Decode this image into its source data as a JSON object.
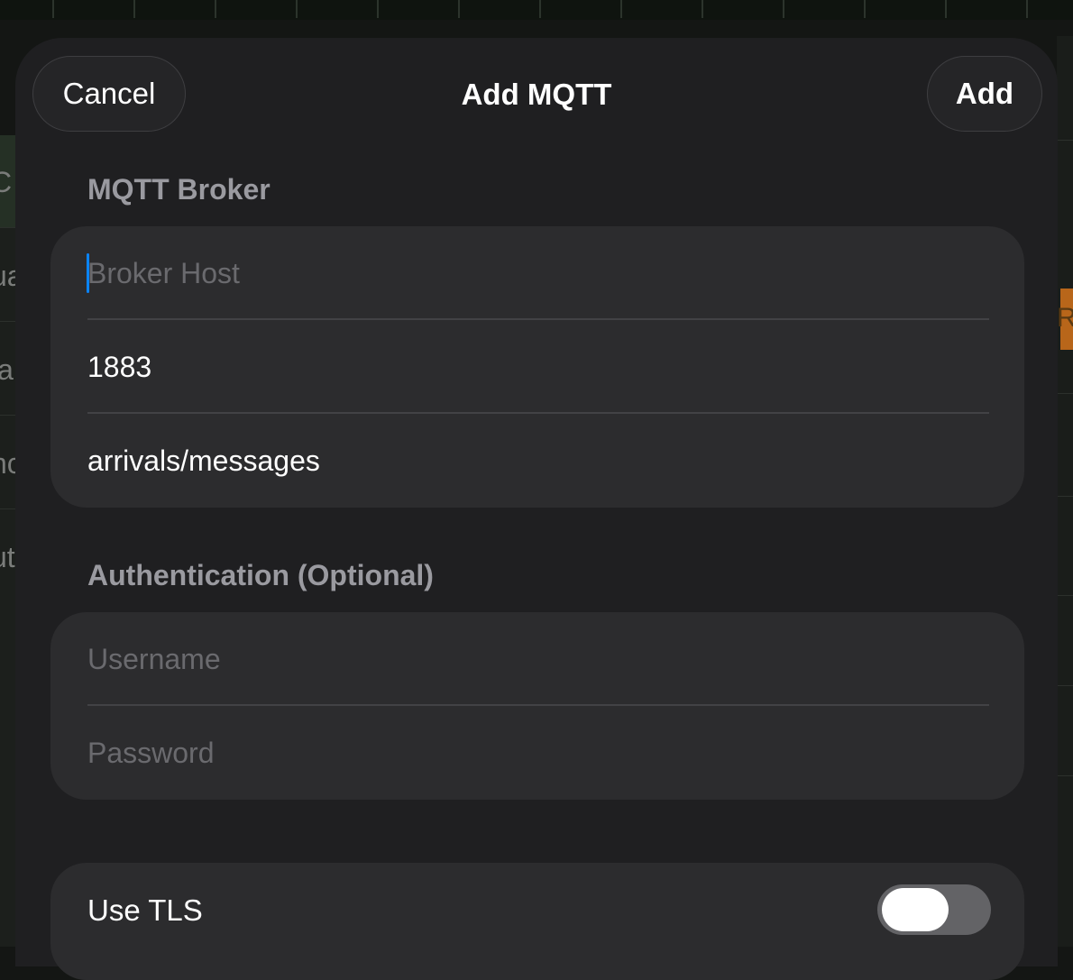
{
  "nav": {
    "cancel_label": "Cancel",
    "title": "Add MQTT",
    "add_label": "Add"
  },
  "broker": {
    "header": "MQTT Broker",
    "host_placeholder": "Broker Host",
    "host_value": "",
    "port_value": "1883",
    "topic_value": "arrivals/messages"
  },
  "auth": {
    "header": "Authentication (Optional)",
    "username_placeholder": "Username",
    "password_placeholder": "Password"
  },
  "tls": {
    "label": "Use TLS",
    "enabled": false
  },
  "background": {
    "left_glyphs": [
      "C",
      "ua",
      "la",
      "nc",
      "ut"
    ],
    "right_glyph": "Ri"
  },
  "colors": {
    "accent_caret": "#0a84ff",
    "sheet_bg": "#1f1f21",
    "card_bg": "#2c2c2e"
  }
}
